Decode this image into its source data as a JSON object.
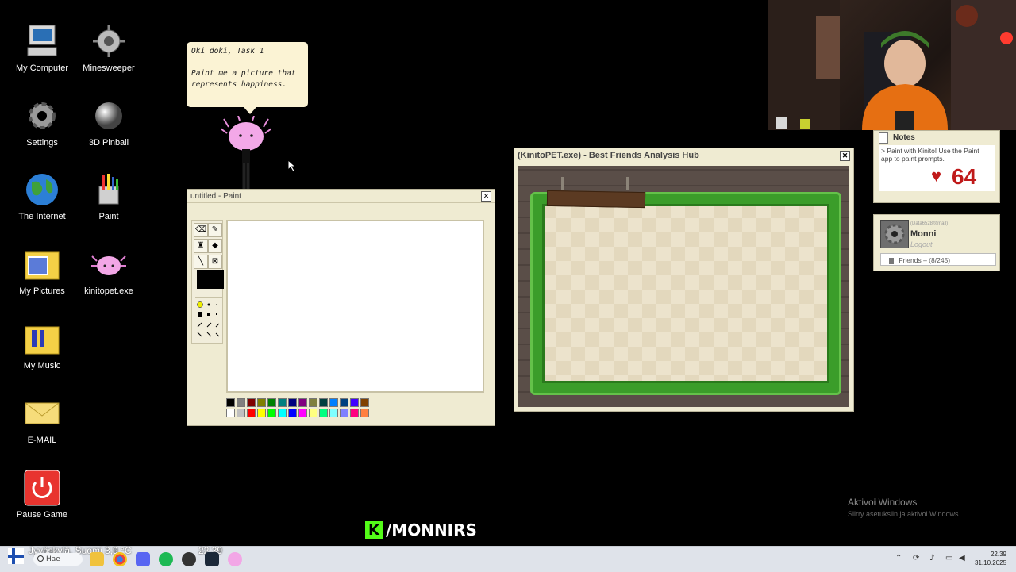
{
  "desktop": {
    "icons": [
      {
        "label": "My Computer",
        "icon": "computer-icon"
      },
      {
        "label": "Minesweeper",
        "icon": "mine-icon"
      },
      {
        "label": "Settings",
        "icon": "gear-icon"
      },
      {
        "label": "3D Pinball",
        "icon": "pinball-icon"
      },
      {
        "label": "The Internet",
        "icon": "globe-icon"
      },
      {
        "label": "Paint",
        "icon": "paint-bucket-icon"
      },
      {
        "label": "My Pictures",
        "icon": "folder-pictures-icon"
      },
      {
        "label": "kinitopet.exe",
        "icon": "kinito-icon"
      },
      {
        "label": "My Music",
        "icon": "folder-music-icon"
      },
      {
        "label": "E-MAIL",
        "icon": "envelope-icon"
      },
      {
        "label": "Pause Game",
        "icon": "power-icon"
      }
    ]
  },
  "bubble": {
    "line1": "Oki doki, Task 1",
    "line2": "Paint me a picture that represents happiness."
  },
  "paint_window": {
    "title": "untitled - Paint",
    "close": "✕",
    "palette_colors": [
      "#000000",
      "#808080",
      "#800000",
      "#808000",
      "#008000",
      "#008080",
      "#000080",
      "#800080",
      "#808040",
      "#004040",
      "#0080ff",
      "#004080",
      "#4000ff",
      "#804000",
      "#ffffff",
      "#c0c0c0",
      "#ff0000",
      "#ffff00",
      "#00ff00",
      "#00ffff",
      "#0000ff",
      "#ff00ff",
      "#ffff80",
      "#00ff80",
      "#80ffff",
      "#8080ff",
      "#ff0080",
      "#ff8040"
    ]
  },
  "hub_window": {
    "title": "(KinitoPET.exe) - Best Friends Analysis Hub",
    "close": "✕"
  },
  "notes": {
    "title": "Notes",
    "text": "> Paint with Kinito! Use the Paint app to paint prompts.",
    "hearts": "64"
  },
  "profile": {
    "email": "(Data6528@mail)",
    "name": "Monni",
    "logout": "Logout",
    "friends": "Friends – (8/245)"
  },
  "watermark": {
    "line1": "Aktivoi Windows",
    "line2": "Siirry asetuksiin ja aktivoi Windows."
  },
  "stream": {
    "handle": "/MONNIRS"
  },
  "taskbar": {
    "weather": "Jyväskylä, Suomi   3,9 °C",
    "search": "Hae",
    "time": "22.39",
    "date": "31.10.2025",
    "clock_overlay": "22.39"
  }
}
